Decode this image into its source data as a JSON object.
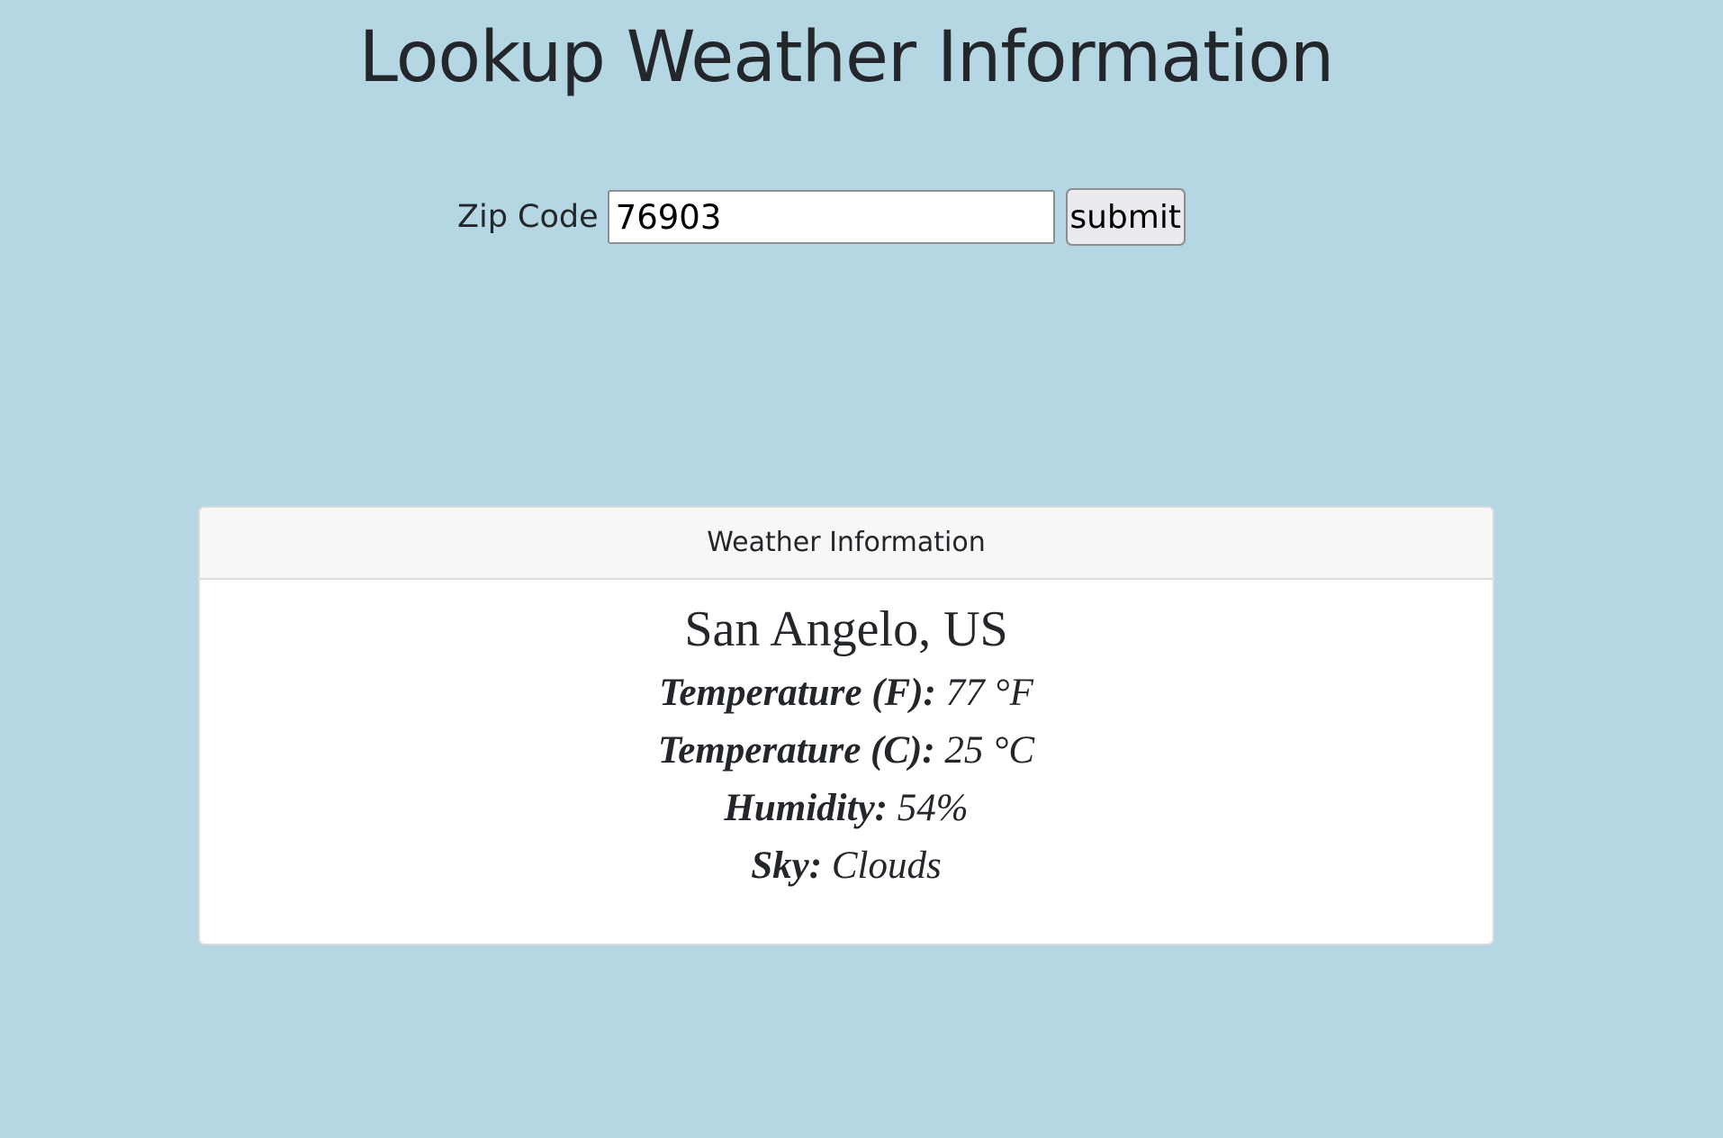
{
  "page": {
    "title": "Lookup Weather Information"
  },
  "form": {
    "zip_label": "Zip Code",
    "zip_value": "76903",
    "submit_label": "submit"
  },
  "card": {
    "header": "Weather Information",
    "location": "San Angelo, US",
    "rows": [
      {
        "label": "Temperature (F):",
        "value": "77 °F"
      },
      {
        "label": "Temperature (C):",
        "value": "25 °C"
      },
      {
        "label": "Humidity:",
        "value": "54%"
      },
      {
        "label": "Sky:",
        "value": "Clouds"
      }
    ]
  },
  "colors": {
    "background": "#b5d7e3",
    "text": "#23272b",
    "card_header_bg": "#f7f7f7",
    "card_bg": "#ffffff"
  }
}
